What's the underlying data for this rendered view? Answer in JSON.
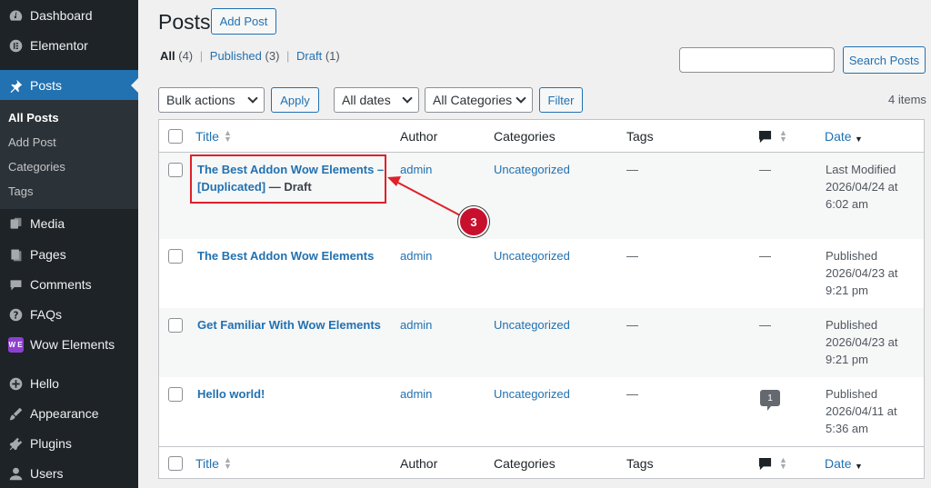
{
  "sidebar": {
    "items": [
      {
        "label": "Dashboard",
        "icon": "dashboard-icon"
      },
      {
        "label": "Elementor",
        "icon": "elementor-icon"
      },
      {
        "label": "Posts",
        "icon": "pin-icon"
      },
      {
        "label": "Media",
        "icon": "media-icon"
      },
      {
        "label": "Pages",
        "icon": "pages-icon"
      },
      {
        "label": "Comments",
        "icon": "comments-icon"
      },
      {
        "label": "FAQs",
        "icon": "question-icon"
      },
      {
        "label": "Wow Elements",
        "icon": "wow-elements-icon",
        "badge": "W E"
      },
      {
        "label": "Hello",
        "icon": "plus-circle-icon"
      },
      {
        "label": "Appearance",
        "icon": "paintbrush-icon"
      },
      {
        "label": "Plugins",
        "icon": "plugin-icon"
      },
      {
        "label": "Users",
        "icon": "user-icon"
      }
    ],
    "submenu": [
      "All Posts",
      "Add Post",
      "Categories",
      "Tags"
    ]
  },
  "header": {
    "title": "Posts",
    "add_button": "Add Post"
  },
  "views": {
    "all": "All",
    "all_count": "(4)",
    "published": "Published",
    "published_count": "(3)",
    "draft": "Draft",
    "draft_count": "(1)",
    "sep": "|"
  },
  "search": {
    "value": "",
    "button": "Search Posts"
  },
  "filters": {
    "bulk": "Bulk actions",
    "apply": "Apply",
    "dates": "All dates",
    "categories": "All Categories",
    "filter": "Filter",
    "items_count": "4 items"
  },
  "table": {
    "columns": {
      "title": "Title",
      "author": "Author",
      "categories": "Categories",
      "tags": "Tags",
      "date": "Date"
    },
    "rows": [
      {
        "title_line1": "The Best Addon Wow Elements –",
        "title_line2": "[Duplicated]",
        "state": " — Draft",
        "author": "admin",
        "category": "Uncategorized",
        "tags": "—",
        "comments": "—",
        "date_status": "Last Modified",
        "date_day": "2026/04/24 at",
        "date_time": "6:02 am"
      },
      {
        "title_line1": "The Best Addon Wow Elements",
        "author": "admin",
        "category": "Uncategorized",
        "tags": "—",
        "comments": "—",
        "date_status": "Published",
        "date_day": "2026/04/23 at",
        "date_time": "9:21 pm"
      },
      {
        "title_line1": "Get Familiar With Wow Elements",
        "author": "admin",
        "category": "Uncategorized",
        "tags": "—",
        "comments": "—",
        "date_status": "Published",
        "date_day": "2026/04/23 at",
        "date_time": "9:21 pm"
      },
      {
        "title_line1": "Hello world!",
        "author": "admin",
        "category": "Uncategorized",
        "tags": "—",
        "comments": "1",
        "date_status": "Published",
        "date_day": "2026/04/11 at",
        "date_time": "5:36 am"
      }
    ]
  },
  "annotation": {
    "step": "3",
    "color": "#c8102e"
  },
  "colors": {
    "accent": "#2271b1",
    "sidebar": "#1d2327",
    "highlight": "#e0202a"
  }
}
